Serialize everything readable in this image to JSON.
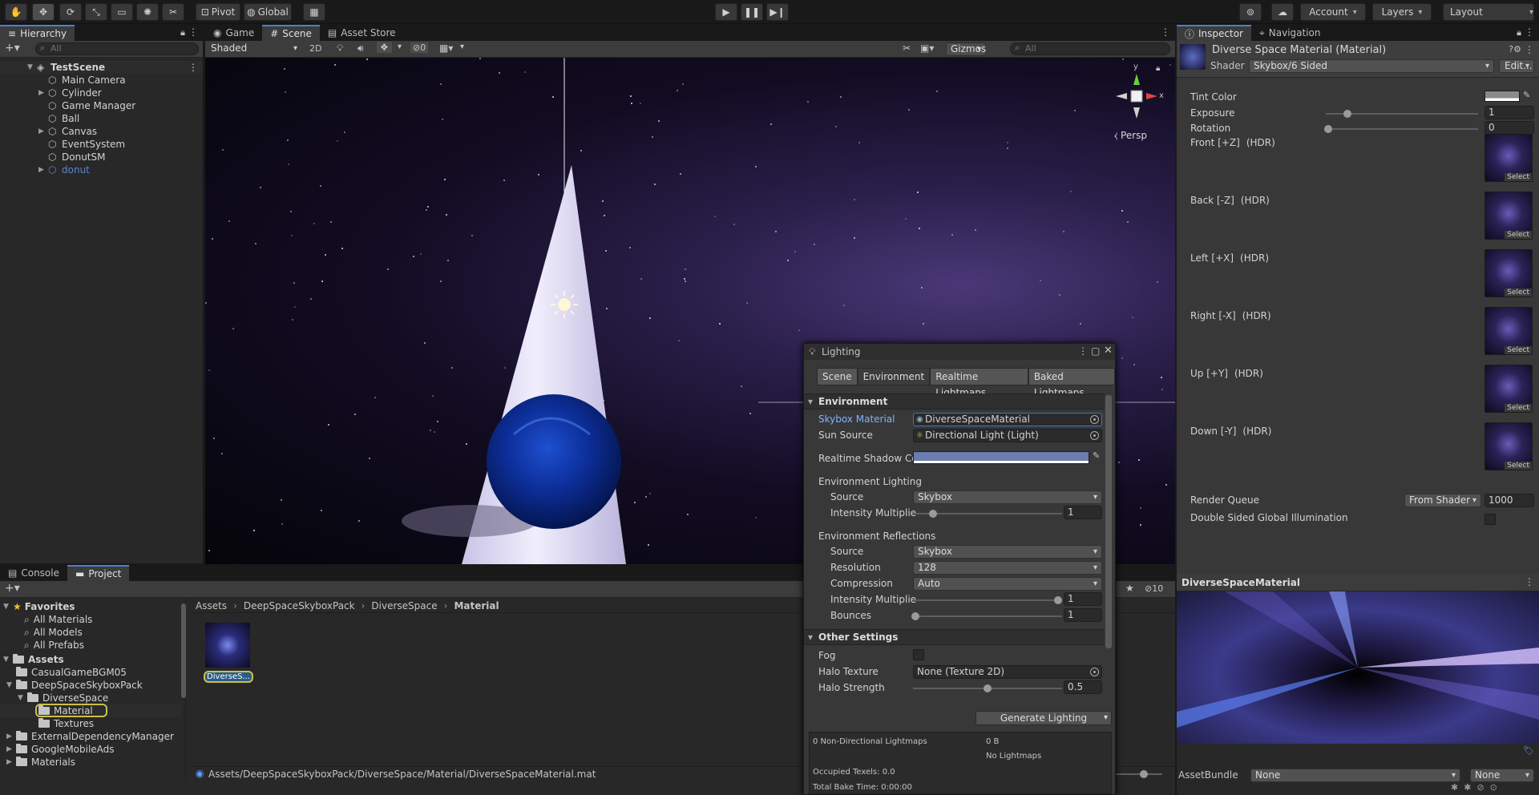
{
  "toolbar": {
    "pivot": "Pivot",
    "global": "Global",
    "account": "Account",
    "layers": "Layers",
    "layout": "Layout"
  },
  "hierarchy": {
    "tab": "Hierarchy",
    "search_placeholder": "All",
    "scene_name": "TestScene",
    "items": [
      {
        "label": "Main Camera",
        "expandable": false
      },
      {
        "label": "Cylinder",
        "expandable": true
      },
      {
        "label": "Game Manager",
        "expandable": false
      },
      {
        "label": "Ball",
        "expandable": false
      },
      {
        "label": "Canvas",
        "expandable": true
      },
      {
        "label": "EventSystem",
        "expandable": false
      },
      {
        "label": "DonutSM",
        "expandable": false
      },
      {
        "label": "donut",
        "expandable": true
      }
    ]
  },
  "scene_view": {
    "tabs": [
      "Game",
      "Scene",
      "Asset Store"
    ],
    "shading_mode": "Shaded",
    "mode_2d": "2D",
    "hidden_count": "0",
    "gizmos": "Gizmos",
    "search_placeholder": "All",
    "projection": "Persp",
    "axis_x": "x",
    "axis_y": "y"
  },
  "inspector": {
    "tabs": [
      "Inspector",
      "Navigation"
    ],
    "title": "Diverse Space Material (Material)",
    "shader_label": "Shader",
    "shader_value": "Skybox/6 Sided",
    "edit_button": "Edit...",
    "tint_color_label": "Tint Color",
    "exposure_label": "Exposure",
    "exposure_value": "1",
    "rotation_label": "Rotation",
    "rotation_value": "0",
    "faces": [
      {
        "label": "Front [+Z]",
        "hdr": "(HDR)"
      },
      {
        "label": "Back [-Z]",
        "hdr": "(HDR)"
      },
      {
        "label": "Left [+X]",
        "hdr": "(HDR)"
      },
      {
        "label": "Right [-X]",
        "hdr": "(HDR)"
      },
      {
        "label": "Up [+Y]",
        "hdr": "(HDR)"
      },
      {
        "label": "Down [-Y]",
        "hdr": "(HDR)"
      }
    ],
    "select_label": "Select",
    "render_queue_label": "Render Queue",
    "render_queue_mode": "From Shader",
    "render_queue_value": "1000",
    "double_sided_gi_label": "Double Sided Global Illumination",
    "preview_title": "DiverseSpaceMaterial",
    "asset_bundle_label": "AssetBundle",
    "asset_bundle_value": "None",
    "asset_bundle_variant": "None"
  },
  "lighting": {
    "title": "Lighting",
    "tabs": [
      "Scene",
      "Environment",
      "Realtime Lightmaps",
      "Baked Lightmaps"
    ],
    "environment_header": "Environment",
    "skybox_material_label": "Skybox Material",
    "skybox_material_value": "DiverseSpaceMaterial",
    "sun_source_label": "Sun Source",
    "sun_source_value": "Directional Light (Light)",
    "realtime_shadow_label": "Realtime Shadow Co",
    "env_lighting_header": "Environment Lighting",
    "source_label": "Source",
    "env_lighting_source": "Skybox",
    "intensity_label": "Intensity Multiplie",
    "env_lighting_intensity": "1",
    "env_reflections_header": "Environment Reflections",
    "env_reflections_source": "Skybox",
    "resolution_label": "Resolution",
    "resolution_value": "128",
    "compression_label": "Compression",
    "compression_value": "Auto",
    "reflection_intensity": "1",
    "bounces_label": "Bounces",
    "bounces_value": "1",
    "other_header": "Other Settings",
    "fog_label": "Fog",
    "halo_texture_label": "Halo Texture",
    "halo_texture_value": "None (Texture 2D)",
    "halo_strength_label": "Halo Strength",
    "halo_strength_value": "0.5",
    "generate_button": "Generate Lighting",
    "stats_lightmaps_label": "0 Non-Directional Lightmaps",
    "stats_lightmaps_size": "0 B",
    "stats_no_lightmaps": "No Lightmaps",
    "stats_texels": "Occupied Texels: 0.0",
    "stats_bake_time": "Total Bake Time: 0:00:00"
  },
  "project": {
    "tabs": [
      "Console",
      "Project"
    ],
    "hidden_count": "10",
    "favorites_header": "Favorites",
    "favorites": [
      "All Materials",
      "All Models",
      "All Prefabs"
    ],
    "assets_header": "Assets",
    "tree": [
      {
        "label": "CasualGameBGM05",
        "indent": 1
      },
      {
        "label": "DeepSpaceSkyboxPack",
        "indent": 1
      },
      {
        "label": "DiverseSpace",
        "indent": 2
      },
      {
        "label": "Material",
        "indent": 3
      },
      {
        "label": "Textures",
        "indent": 3
      },
      {
        "label": "ExternalDependencyManager",
        "indent": 1
      },
      {
        "label": "GoogleMobileAds",
        "indent": 1
      },
      {
        "label": "Materials",
        "indent": 1
      }
    ],
    "breadcrumb": [
      "Assets",
      "DeepSpaceSkyboxPack",
      "DiverseSpace",
      "Material"
    ],
    "asset_label": "DiverseS...",
    "status_path": "Assets/DeepSpaceSkyboxPack/DiverseSpace/Material/DiverseSpaceMaterial.mat"
  }
}
